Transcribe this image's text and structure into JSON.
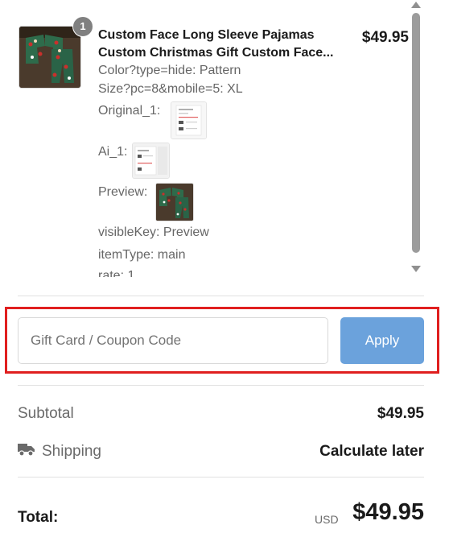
{
  "product": {
    "quantity": "1",
    "title_line1": "Custom Face Long Sleeve Pajamas",
    "title_line2": "Custom Christmas Gift Custom Face...",
    "price": "$49.95",
    "properties": {
      "color": "Color?type=hide: Pattern",
      "size": "Size?pc=8&mobile=5: XL",
      "original_label": "Original_1:",
      "ai_label": "Ai_1:",
      "preview_label": "Preview:",
      "visible_key": "visibleKey:  Preview",
      "item_type": "itemType:  main",
      "rate": "rate:  1"
    },
    "thumbnail_icon": "pajamas-product-photo",
    "preview_icon": "pajamas-preview-image"
  },
  "coupon": {
    "placeholder": "Gift Card / Coupon Code",
    "apply_label": "Apply",
    "apply_color": "#6ba2dc",
    "highlight_color": "#e01f1f"
  },
  "summary": {
    "subtotal_label": "Subtotal",
    "subtotal_value": "$49.95",
    "shipping_label": "Shipping",
    "shipping_value": "Calculate later",
    "shipping_icon": "truck-icon",
    "total_label": "Total:",
    "currency": "USD",
    "total_value": "$49.95"
  }
}
